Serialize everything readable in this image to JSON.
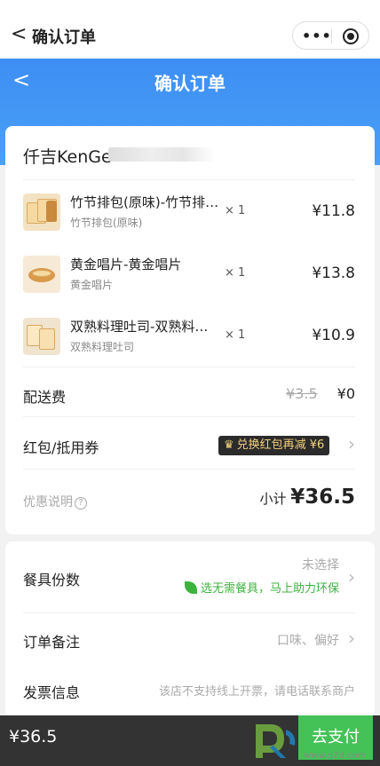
{
  "mini_program_bar": {
    "back_glyph": "<",
    "title": "确认订单",
    "menu_glyph": "•••"
  },
  "header": {
    "back_glyph": "<",
    "title": "确认订单"
  },
  "shop": {
    "name": "仟吉KenGe"
  },
  "items": [
    {
      "name": "竹节排包(原味)-竹节排包(原味)",
      "spec": "竹节排包(原味)",
      "qty": "× 1",
      "price": "¥11.8",
      "icon": "bread-icon"
    },
    {
      "name": "黄金唱片-黄金唱片",
      "spec": "黄金唱片",
      "qty": "× 1",
      "price": "¥13.8",
      "icon": "pastry-icon"
    },
    {
      "name": "双熟料理吐司-双熟料理吐司",
      "spec": "双熟料理吐司",
      "qty": "× 1",
      "price": "¥10.9",
      "icon": "toast-icon"
    }
  ],
  "delivery": {
    "label": "配送费",
    "original": "¥3.5",
    "value": "¥0"
  },
  "coupon_row": {
    "label": "红包/抵用券",
    "badge": "兑换红包再减 ¥6"
  },
  "promo": {
    "label": "优惠说明",
    "help_glyph": "?"
  },
  "subtotal": {
    "label": "小计 ",
    "amount": "¥36.5"
  },
  "tableware": {
    "label": "餐具份数",
    "status": "未选择",
    "eco_tip": "选无需餐具，马上助力环保"
  },
  "remark": {
    "label": "订单备注",
    "placeholder": "口味、偏好"
  },
  "invoice": {
    "label": "发票信息",
    "note": "该店不支持线上开票，请电话联系商户"
  },
  "bottom_bar": {
    "total": "¥36.5",
    "pay_label": "去支付"
  },
  "watermark": {
    "url": "www.q2d.com"
  },
  "colors": {
    "header_blue": "#3d8ef3",
    "pay_green": "#44c257",
    "eco_green": "#3db23d",
    "coupon_gold": "#f4d27a"
  }
}
